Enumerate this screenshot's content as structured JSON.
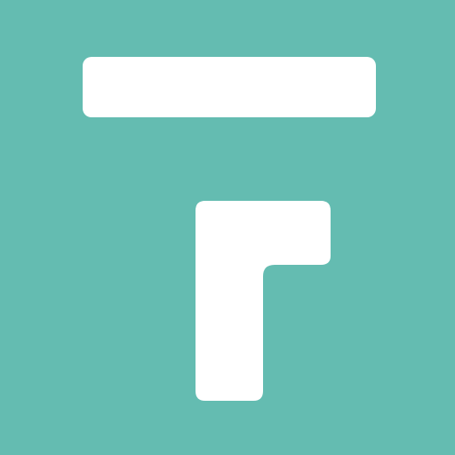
{
  "icon": {
    "name": "app-logo-icon",
    "description_name": "teal-square-with-bar-and-hook"
  },
  "colors": {
    "background": "#64bcb1",
    "foreground": "#ffffff"
  }
}
